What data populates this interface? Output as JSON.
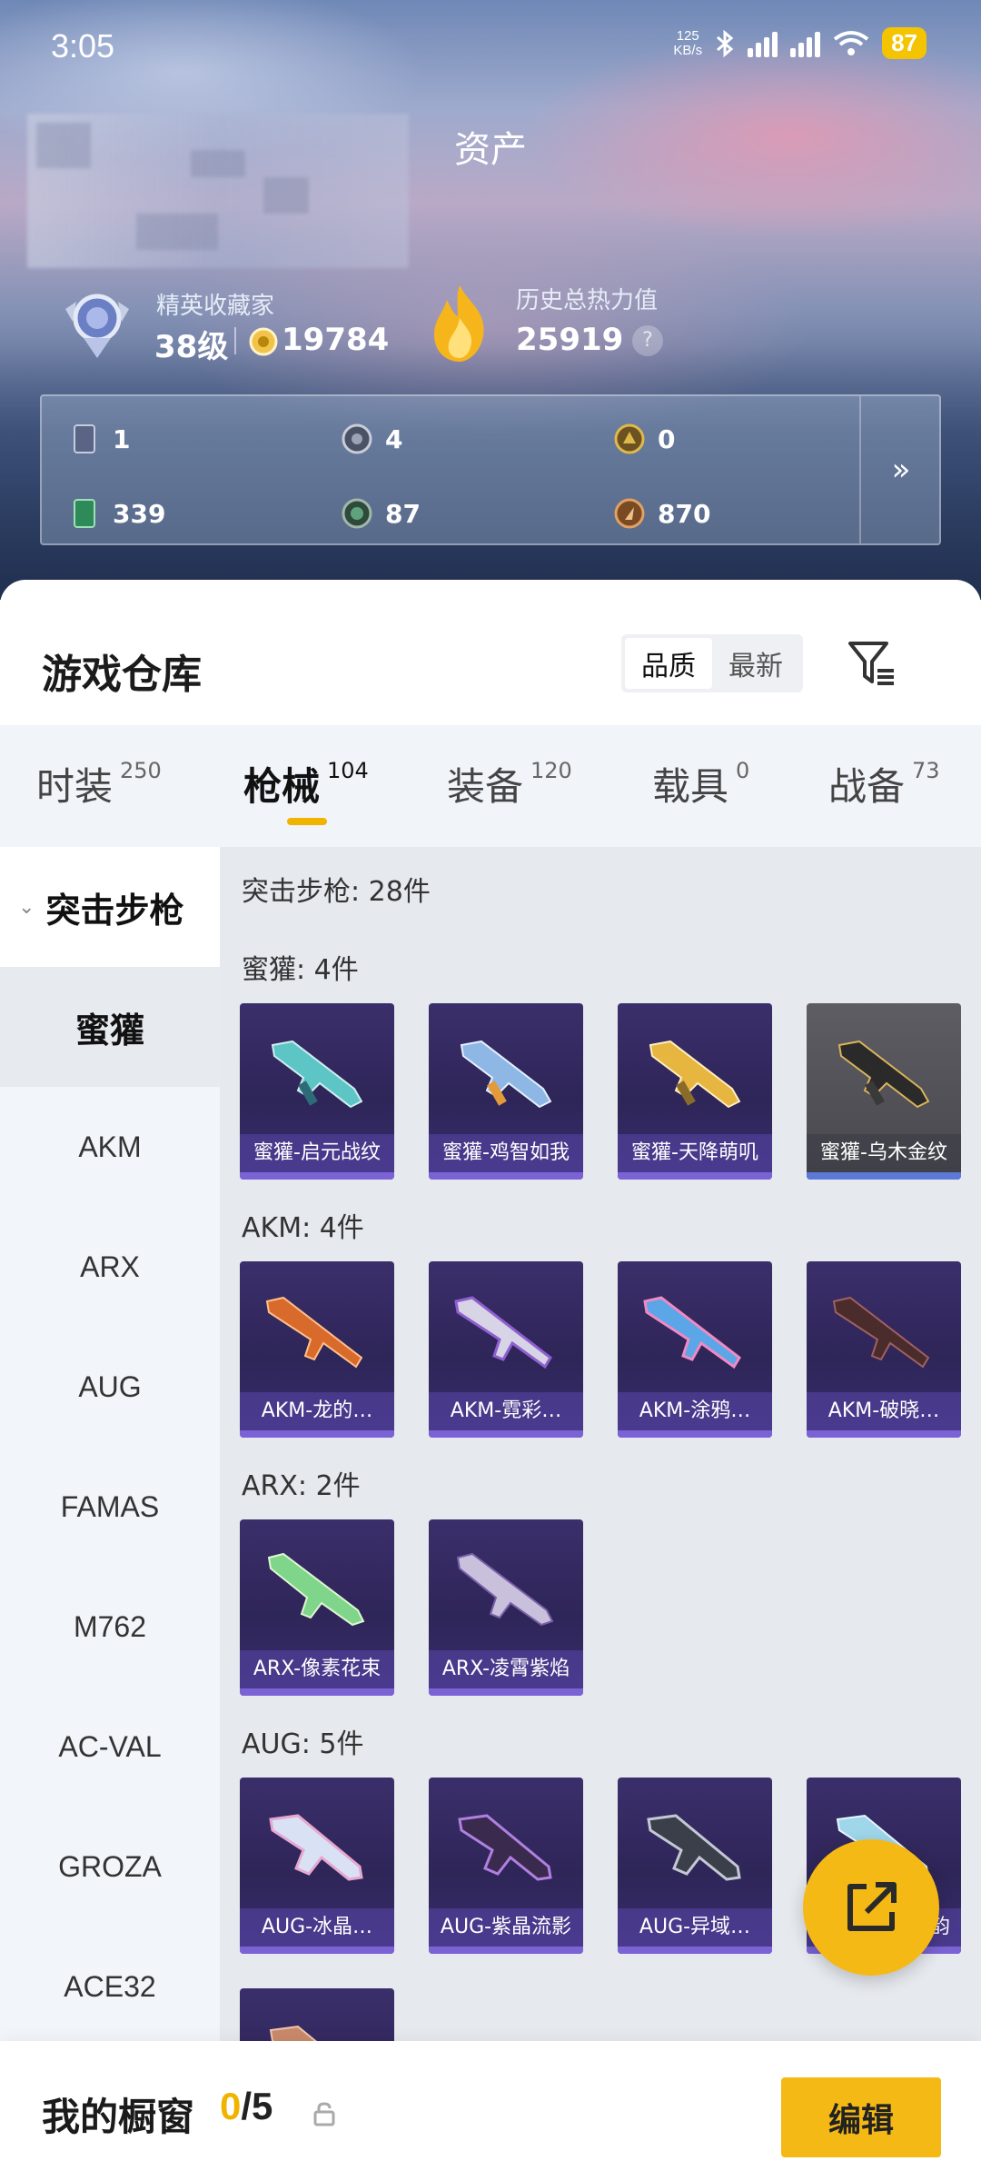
{
  "status_bar": {
    "time": "3:05",
    "net_speed_top": "125",
    "net_speed_bottom": "KB/s",
    "battery": "87"
  },
  "hero": {
    "title": "资产",
    "rank_label": "精英收藏家",
    "rank_level": "38级",
    "coin_value": "19784",
    "heat_label": "历史总热力值",
    "heat_value": "25919",
    "help": "?",
    "more": "»",
    "stats": [
      "1",
      "4",
      "0",
      "339",
      "87",
      "870"
    ]
  },
  "warehouse": {
    "title": "游戏仓库",
    "sort_options": [
      "品质",
      "最新"
    ],
    "active_sort": "品质"
  },
  "tabs": [
    {
      "label": "时装",
      "count": "250"
    },
    {
      "label": "枪械",
      "count": "104"
    },
    {
      "label": "装备",
      "count": "120"
    },
    {
      "label": "载具",
      "count": "0"
    },
    {
      "label": "战备",
      "count": "73"
    }
  ],
  "side_nav": {
    "header": "突击步枪",
    "items": [
      "蜜獾",
      "AKM",
      "ARX",
      "AUG",
      "FAMAS",
      "M762",
      "AC-VAL",
      "GROZA",
      "ACE32"
    ]
  },
  "content": {
    "category_title": "突击步枪: 28件",
    "groups": [
      {
        "title": "蜜獾: 4件",
        "items": [
          "蜜獾-启元战纹",
          "蜜獾-鸡智如我",
          "蜜獾-天降萌叽",
          "蜜獾-乌木金纹"
        ]
      },
      {
        "title": "AKM: 4件",
        "items": [
          "AKM-龙的…",
          "AKM-霓彩…",
          "AKM-涂鸦…",
          "AKM-破晓…"
        ]
      },
      {
        "title": "ARX: 2件",
        "items": [
          "ARX-像素花束",
          "ARX-凌霄紫焰"
        ]
      },
      {
        "title": "AUG: 5件",
        "items": [
          "AUG-冰晶…",
          "AUG-紫晶流影",
          "AUG-异域…",
          "韵"
        ]
      }
    ]
  },
  "bottom_bar": {
    "label": "我的橱窗",
    "current": "0",
    "total": "/5",
    "edit": "编辑"
  },
  "colors": {
    "accent": "#f5b915",
    "card_purple": "#2e2558",
    "tab_underline": "#f0b400"
  }
}
